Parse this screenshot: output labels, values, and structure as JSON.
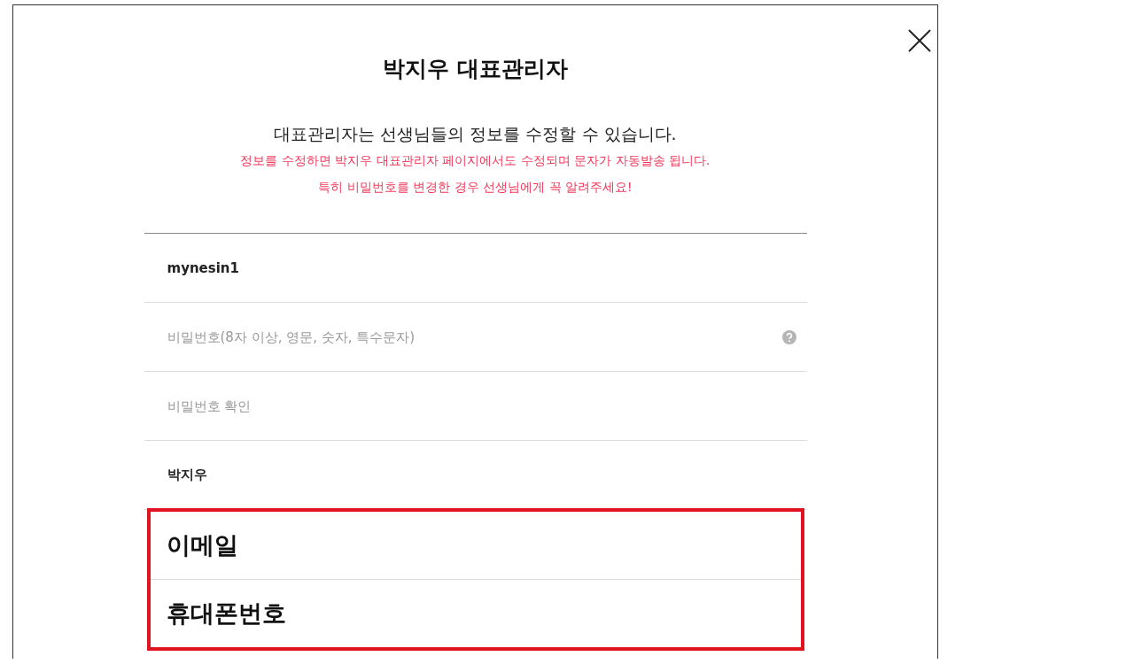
{
  "dialog": {
    "title": "박지우 대표관리자",
    "description": "대표관리자는 선생님들의 정보를 수정할 수 있습니다.",
    "warnings": [
      "정보를 수정하면 박지우 대표관리자 페이지에서도 수정되며 문자가 자동발송 됩니다.",
      "특히 비밀번호를 변경한 경우 선생님에게 꼭 알려주세요!"
    ],
    "fields": [
      {
        "kind": "value",
        "value": "mynesin1"
      },
      {
        "kind": "password",
        "placeholder": "비밀번호(8자 이상, 영문, 숫자, 특수문자)",
        "help": true
      },
      {
        "kind": "password",
        "placeholder": "비밀번호 확인"
      },
      {
        "kind": "value",
        "value": "박지우"
      }
    ],
    "highlighted_fields": [
      {
        "label": "이메일"
      },
      {
        "label": "휴대폰번호"
      }
    ]
  }
}
